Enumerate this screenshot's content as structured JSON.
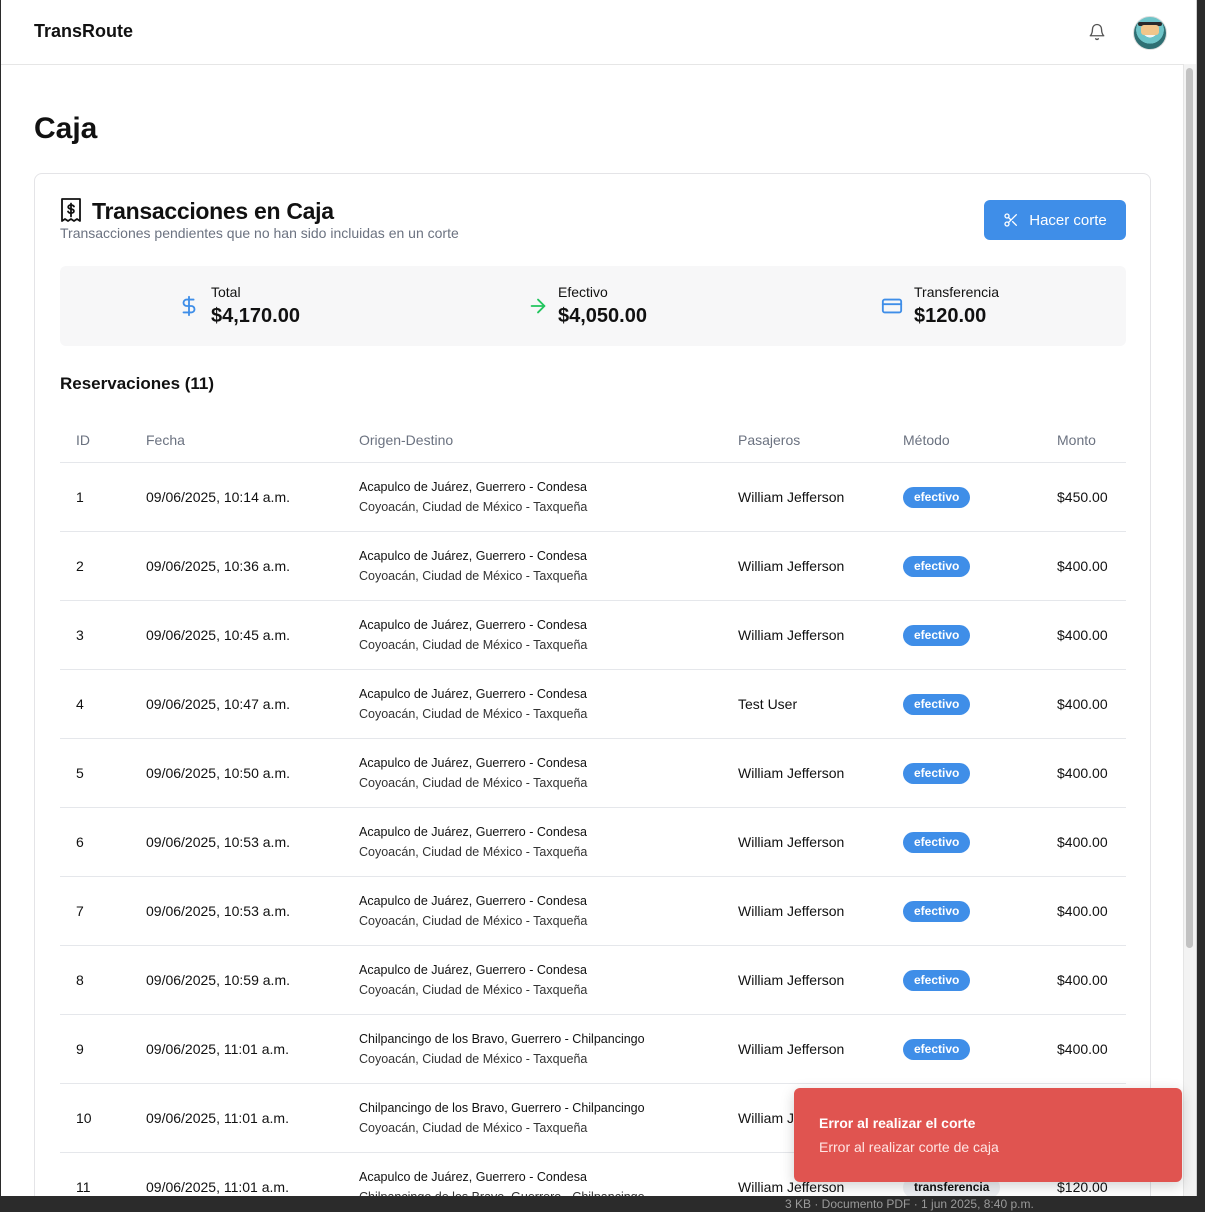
{
  "app": {
    "brand": "TransRoute"
  },
  "page": {
    "title": "Caja"
  },
  "card": {
    "title": "Transacciones en Caja",
    "subtitle": "Transacciones pendientes que no han sido incluidas en un corte",
    "button_label": "Hacer corte"
  },
  "summary": {
    "total_label": "Total",
    "total_value": "$4,170.00",
    "efectivo_label": "Efectivo",
    "efectivo_value": "$4,050.00",
    "transfer_label": "Transferencia",
    "transfer_value": "$120.00"
  },
  "reservations": {
    "title": "Reservaciones (11)",
    "columns": [
      "ID",
      "Fecha",
      "Origen-Destino",
      "Pasajeros",
      "Método",
      "Monto"
    ],
    "rows": [
      {
        "id": "1",
        "fecha": "09/06/2025, 10:14 a.m.",
        "ruta1": "Acapulco de Juárez, Guerrero - Condesa",
        "ruta2": "Coyoacán, Ciudad de México - Taxqueña",
        "pasajeros": "William Jefferson",
        "metodo": "efectivo",
        "monto": "$450.00"
      },
      {
        "id": "2",
        "fecha": "09/06/2025, 10:36 a.m.",
        "ruta1": "Acapulco de Juárez, Guerrero - Condesa",
        "ruta2": "Coyoacán, Ciudad de México - Taxqueña",
        "pasajeros": "William Jefferson",
        "metodo": "efectivo",
        "monto": "$400.00"
      },
      {
        "id": "3",
        "fecha": "09/06/2025, 10:45 a.m.",
        "ruta1": "Acapulco de Juárez, Guerrero - Condesa",
        "ruta2": "Coyoacán, Ciudad de México - Taxqueña",
        "pasajeros": "William Jefferson",
        "metodo": "efectivo",
        "monto": "$400.00"
      },
      {
        "id": "4",
        "fecha": "09/06/2025, 10:47 a.m.",
        "ruta1": "Acapulco de Juárez, Guerrero - Condesa",
        "ruta2": "Coyoacán, Ciudad de México - Taxqueña",
        "pasajeros": "Test User",
        "metodo": "efectivo",
        "monto": "$400.00"
      },
      {
        "id": "5",
        "fecha": "09/06/2025, 10:50 a.m.",
        "ruta1": "Acapulco de Juárez, Guerrero - Condesa",
        "ruta2": "Coyoacán, Ciudad de México - Taxqueña",
        "pasajeros": "William Jefferson",
        "metodo": "efectivo",
        "monto": "$400.00"
      },
      {
        "id": "6",
        "fecha": "09/06/2025, 10:53 a.m.",
        "ruta1": "Acapulco de Juárez, Guerrero - Condesa",
        "ruta2": "Coyoacán, Ciudad de México - Taxqueña",
        "pasajeros": "William Jefferson",
        "metodo": "efectivo",
        "monto": "$400.00"
      },
      {
        "id": "7",
        "fecha": "09/06/2025, 10:53 a.m.",
        "ruta1": "Acapulco de Juárez, Guerrero - Condesa",
        "ruta2": "Coyoacán, Ciudad de México - Taxqueña",
        "pasajeros": "William Jefferson",
        "metodo": "efectivo",
        "monto": "$400.00"
      },
      {
        "id": "8",
        "fecha": "09/06/2025, 10:59 a.m.",
        "ruta1": "Acapulco de Juárez, Guerrero - Condesa",
        "ruta2": "Coyoacán, Ciudad de México - Taxqueña",
        "pasajeros": "William Jefferson",
        "metodo": "efectivo",
        "monto": "$400.00"
      },
      {
        "id": "9",
        "fecha": "09/06/2025, 11:01 a.m.",
        "ruta1": "Chilpancingo de los Bravo, Guerrero - Chilpancingo",
        "ruta2": "Coyoacán, Ciudad de México - Taxqueña",
        "pasajeros": "William Jefferson",
        "metodo": "efectivo",
        "monto": "$400.00"
      },
      {
        "id": "10",
        "fecha": "09/06/2025, 11:01 a.m.",
        "ruta1": "Chilpancingo de los Bravo, Guerrero - Chilpancingo",
        "ruta2": "Coyoacán, Ciudad de México - Taxqueña",
        "pasajeros": "William Jefferson",
        "metodo": "",
        "monto": ""
      },
      {
        "id": "11",
        "fecha": "09/06/2025, 11:01 a.m.",
        "ruta1": "Acapulco de Juárez, Guerrero - Condesa",
        "ruta2": "Chilpancingo de los Bravo, Guerrero - Chilpancingo",
        "pasajeros": "William Jefferson",
        "metodo": "transferencia",
        "monto": "$120.00"
      }
    ]
  },
  "toast": {
    "title": "Error al realizar el corte",
    "description": "Error al realizar corte de caja"
  },
  "background_strip": "3 KB · Documento PDF · 1 jun 2025, 8:40 p.m.",
  "colors": {
    "primary": "#3f8ee8",
    "success": "#22c55e",
    "error": "#e05450"
  },
  "icons": [
    "bell-icon",
    "receipt-icon",
    "scissors-icon",
    "dollar-icon",
    "arrow-right-icon",
    "credit-card-icon"
  ]
}
